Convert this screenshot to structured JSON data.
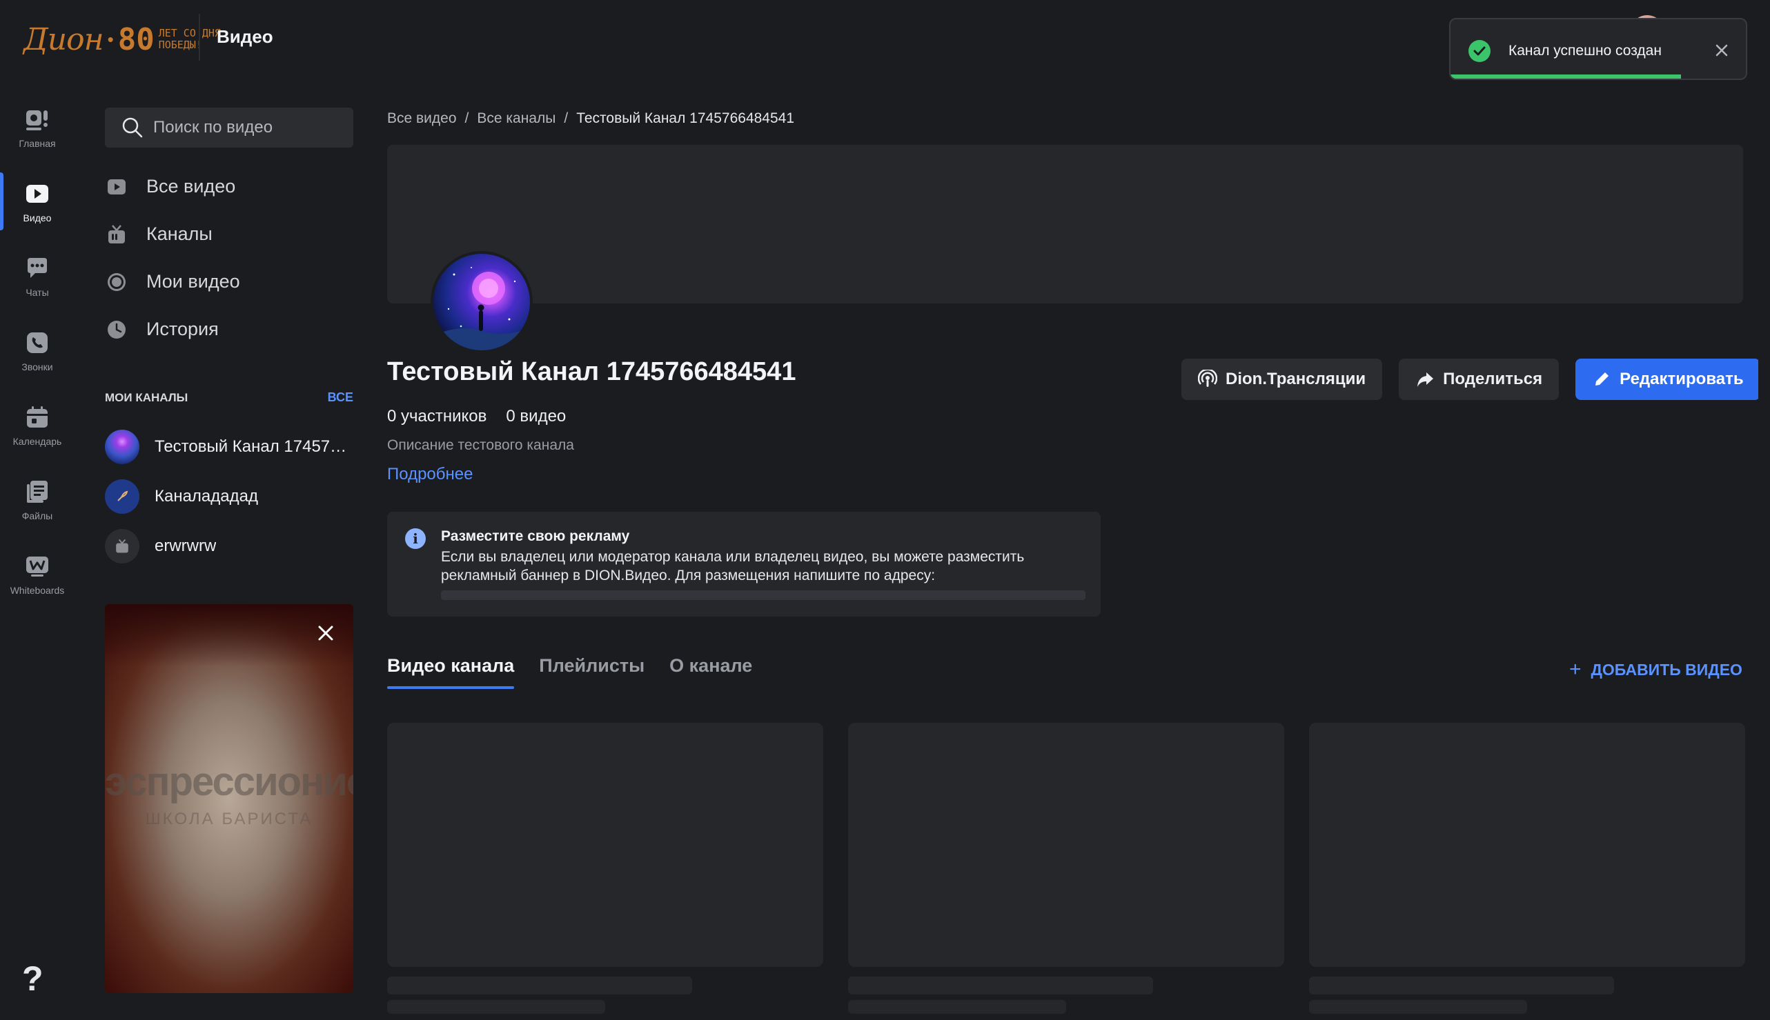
{
  "header": {
    "logo": {
      "script": "Дион",
      "number": "80",
      "subtitle_line1": "ЛЕТ СО ДНЯ",
      "subtitle_line2": "ПОБЕДЫ!"
    },
    "app_title": "Видео"
  },
  "toast": {
    "message": "Канал успешно создан",
    "status_color": "#3cc46b",
    "progress": 0.78
  },
  "rail": [
    {
      "label": "Главная",
      "icon": "home-camera-icon",
      "active": false
    },
    {
      "label": "Видео",
      "icon": "video-play-icon",
      "active": true
    },
    {
      "label": "Чаты",
      "icon": "chat-icon",
      "active": false
    },
    {
      "label": "Звонки",
      "icon": "phone-icon",
      "active": false
    },
    {
      "label": "Календарь",
      "icon": "calendar-icon",
      "active": false
    },
    {
      "label": "Файлы",
      "icon": "files-icon",
      "active": false
    },
    {
      "label": "Whiteboards",
      "icon": "whiteboard-icon",
      "active": false
    }
  ],
  "help_label": "?",
  "search": {
    "placeholder": "Поиск по видео"
  },
  "nav": [
    {
      "label": "Все видео",
      "icon": "play-square-icon"
    },
    {
      "label": "Каналы",
      "icon": "tv-icon"
    },
    {
      "label": "Мои видео",
      "icon": "record-icon"
    },
    {
      "label": "История",
      "icon": "clock-icon"
    }
  ],
  "my_channels": {
    "title": "МОИ КАНАЛЫ",
    "all_label": "ВСЕ",
    "items": [
      {
        "name": "Тестовый Канал 1745766484541"
      },
      {
        "name": "Каналададад"
      },
      {
        "name": "erwrwrw"
      }
    ]
  },
  "promo": {
    "brand": "эспрессионист",
    "subtitle": "ШКОЛА БАРИСТА"
  },
  "breadcrumb": {
    "items": [
      "Все видео",
      "Все каналы"
    ],
    "current": "Тестовый Канал 1745766484541",
    "separator": "/"
  },
  "channel": {
    "title": "Тестовый Канал 1745766484541",
    "members": "0 участников",
    "videos": "0 видео",
    "description": "Описание тестового канала",
    "more_label": "Подробнее"
  },
  "actions": {
    "broadcast_label": "Dion.Трансляции",
    "share_label": "Поделиться",
    "edit_label": "Редактировать"
  },
  "ad": {
    "title": "Разместите свою рекламу",
    "text": "Если вы владелец или модератор канала или владелец видео, вы можете разместить рекламный баннер в DION.Видео. Для размещения напишите по адресу:",
    "info_glyph": "i"
  },
  "tabs": [
    {
      "label": "Видео канала",
      "active": true
    },
    {
      "label": "Плейлисты",
      "active": false
    },
    {
      "label": "О канале",
      "active": false
    }
  ],
  "add_video": {
    "plus": "+",
    "label": "ДОБАВИТЬ ВИДЕО"
  },
  "colors": {
    "accent": "#2d6cf0",
    "link": "#5a92ff",
    "background": "#1b1c1f",
    "success": "#3cc46b"
  }
}
